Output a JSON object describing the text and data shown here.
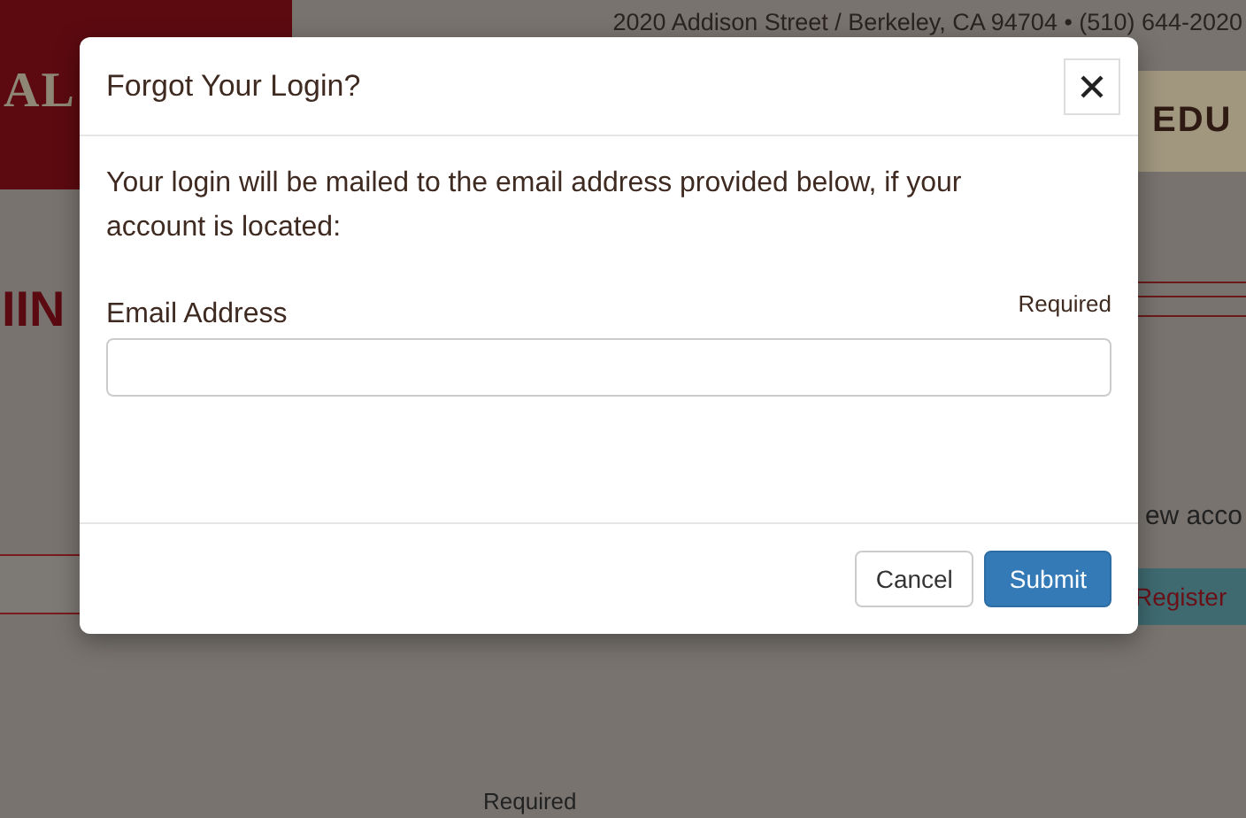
{
  "background_page": {
    "brand": "AL",
    "address": "2020 Addison Street / Berkeley, CA 94704  •  (510) 644-2020",
    "nav_item": "EDU",
    "heading": "IIN",
    "side_text": "ew acco",
    "register_button": "Register",
    "required_note": "Required"
  },
  "dialog": {
    "title": "Forgot Your Login?",
    "message": "Your login will be mailed to the email address provided below, if your account is located:",
    "field": {
      "label": "Email Address",
      "hint": "Required"
    },
    "buttons": [
      {
        "label": "Cancel",
        "kind": "default"
      },
      {
        "label": "Submit",
        "kind": "primary"
      }
    ]
  }
}
